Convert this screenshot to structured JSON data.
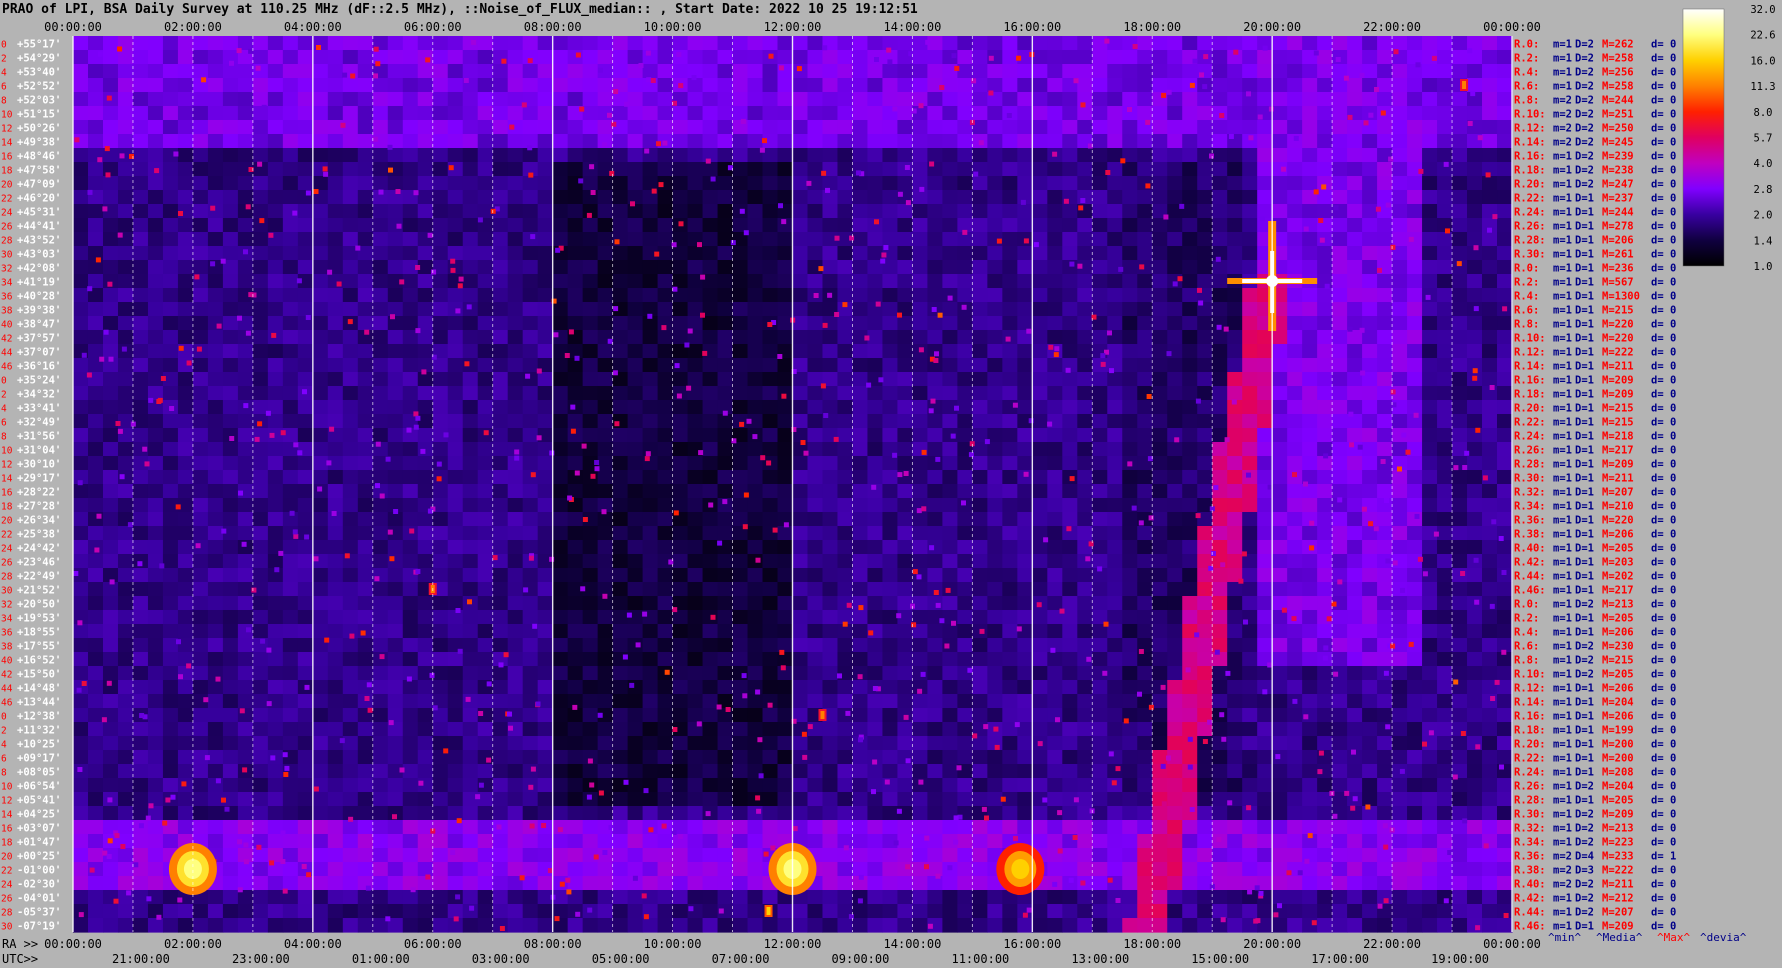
{
  "chart_data": {
    "type": "heatmap",
    "title": "PRAO of LPI, BSA Daily Survey at 110.25 MHz (dF::2.5 MHz), ::Noise_of_FLUX_median:: , Start Date: 2022 10 25 19:12:51",
    "xlabel_ra": "RA >>",
    "xlabel_utc": "UTC>>",
    "ra_ticks": [
      "00:00:00",
      "02:00:00",
      "04:00:00",
      "06:00:00",
      "08:00:00",
      "10:00:00",
      "12:00:00",
      "14:00:00",
      "16:00:00",
      "18:00:00",
      "20:00:00",
      "22:00:00",
      "00:00:00"
    ],
    "utc_ticks": [
      "21:00:00",
      "23:00:00",
      "01:00:00",
      "03:00:00",
      "05:00:00",
      "07:00:00",
      "09:00:00",
      "11:00:00",
      "13:00:00",
      "15:00:00",
      "17:00:00",
      "19:00:00"
    ],
    "dec_labels": [
      "+55°17'",
      "+54°29'",
      "+53°40'",
      "+52°52'",
      "+52°03'",
      "+51°15'",
      "+50°26'",
      "+49°38'",
      "+48°46'",
      "+47°58'",
      "+47°09'",
      "+46°20'",
      "+45°31'",
      "+44°41'",
      "+43°52'",
      "+43°03'",
      "+42°08'",
      "+41°19'",
      "+40°28'",
      "+39°38'",
      "+38°47'",
      "+37°57'",
      "+37°07'",
      "+36°16'",
      "+35°24'",
      "+34°32'",
      "+33°41'",
      "+32°49'",
      "+31°56'",
      "+31°04'",
      "+30°10'",
      "+29°17'",
      "+28°22'",
      "+27°28'",
      "+26°34'",
      "+25°38'",
      "+24°42'",
      "+23°46'",
      "+22°49'",
      "+21°52'",
      "+20°50'",
      "+19°53'",
      "+18°55'",
      "+17°55'",
      "+16°52'",
      "+15°50'",
      "+14°48'",
      "+13°44'",
      "+12°38'",
      "+11°32'",
      "+10°25'",
      "+09°17'",
      "+08°05'",
      "+06°54'",
      "+05°41'",
      "+04°25'",
      "+03°07'",
      "+01°47'",
      "+00°25'",
      "-01°00'",
      "-02°30'",
      "-04°01'",
      "-05°37'",
      "-07°19'"
    ],
    "row_index": [
      "0",
      "2",
      "4",
      "6",
      "8",
      "10",
      "12",
      "14",
      "16",
      "18",
      "20",
      "22",
      "24",
      "26",
      "28",
      "30",
      "32",
      "34",
      "36",
      "38",
      "40",
      "42",
      "44",
      "46",
      "0",
      "2",
      "4",
      "6",
      "8",
      "10",
      "12",
      "14",
      "16",
      "18",
      "20",
      "22",
      "24",
      "26",
      "28",
      "30",
      "32",
      "34",
      "36",
      "38",
      "40",
      "42",
      "44",
      "46",
      "0",
      "2",
      "4",
      "6",
      "8",
      "10",
      "12",
      "14",
      "16",
      "18",
      "20",
      "22",
      "24",
      "26",
      "28",
      "30"
    ],
    "row_stats": [
      {
        "r": "R.0:",
        "m": "m=1",
        "D": "D=2",
        "M": "M=262",
        "d": "d= 0"
      },
      {
        "r": "R.2:",
        "m": "m=1",
        "D": "D=2",
        "M": "M=258",
        "d": "d= 0"
      },
      {
        "r": "R.4:",
        "m": "m=1",
        "D": "D=2",
        "M": "M=256",
        "d": "d= 0"
      },
      {
        "r": "R.6:",
        "m": "m=1",
        "D": "D=2",
        "M": "M=258",
        "d": "d= 0"
      },
      {
        "r": "R.8:",
        "m": "m=2",
        "D": "D=2",
        "M": "M=244",
        "d": "d= 0"
      },
      {
        "r": "R.10:",
        "m": "m=2",
        "D": "D=2",
        "M": "M=251",
        "d": "d= 0"
      },
      {
        "r": "R.12:",
        "m": "m=2",
        "D": "D=2",
        "M": "M=250",
        "d": "d= 0"
      },
      {
        "r": "R.14:",
        "m": "m=2",
        "D": "D=2",
        "M": "M=245",
        "d": "d= 0"
      },
      {
        "r": "R.16:",
        "m": "m=1",
        "D": "D=2",
        "M": "M=239",
        "d": "d= 0"
      },
      {
        "r": "R.18:",
        "m": "m=1",
        "D": "D=2",
        "M": "M=238",
        "d": "d= 0"
      },
      {
        "r": "R.20:",
        "m": "m=1",
        "D": "D=2",
        "M": "M=247",
        "d": "d= 0"
      },
      {
        "r": "R.22:",
        "m": "m=1",
        "D": "D=1",
        "M": "M=237",
        "d": "d= 0"
      },
      {
        "r": "R.24:",
        "m": "m=1",
        "D": "D=1",
        "M": "M=244",
        "d": "d= 0"
      },
      {
        "r": "R.26:",
        "m": "m=1",
        "D": "D=1",
        "M": "M=278",
        "d": "d= 0"
      },
      {
        "r": "R.28:",
        "m": "m=1",
        "D": "D=1",
        "M": "M=206",
        "d": "d= 0"
      },
      {
        "r": "R.30:",
        "m": "m=1",
        "D": "D=1",
        "M": "M=261",
        "d": "d= 0"
      },
      {
        "r": "R.0:",
        "m": "m=1",
        "D": "D=1",
        "M": "M=236",
        "d": "d= 0"
      },
      {
        "r": "R.2:",
        "m": "m=1",
        "D": "D=1",
        "M": "M=567",
        "d": "d= 0"
      },
      {
        "r": "R.4:",
        "m": "m=1",
        "D": "D=1",
        "M": "M=1300",
        "d": "d= 0"
      },
      {
        "r": "R.6:",
        "m": "m=1",
        "D": "D=1",
        "M": "M=215",
        "d": "d= 0"
      },
      {
        "r": "R.8:",
        "m": "m=1",
        "D": "D=1",
        "M": "M=220",
        "d": "d= 0"
      },
      {
        "r": "R.10:",
        "m": "m=1",
        "D": "D=1",
        "M": "M=220",
        "d": "d= 0"
      },
      {
        "r": "R.12:",
        "m": "m=1",
        "D": "D=1",
        "M": "M=222",
        "d": "d= 0"
      },
      {
        "r": "R.14:",
        "m": "m=1",
        "D": "D=1",
        "M": "M=211",
        "d": "d= 0"
      },
      {
        "r": "R.16:",
        "m": "m=1",
        "D": "D=1",
        "M": "M=209",
        "d": "d= 0"
      },
      {
        "r": "R.18:",
        "m": "m=1",
        "D": "D=1",
        "M": "M=209",
        "d": "d= 0"
      },
      {
        "r": "R.20:",
        "m": "m=1",
        "D": "D=1",
        "M": "M=215",
        "d": "d= 0"
      },
      {
        "r": "R.22:",
        "m": "m=1",
        "D": "D=1",
        "M": "M=215",
        "d": "d= 0"
      },
      {
        "r": "R.24:",
        "m": "m=1",
        "D": "D=1",
        "M": "M=218",
        "d": "d= 0"
      },
      {
        "r": "R.26:",
        "m": "m=1",
        "D": "D=1",
        "M": "M=217",
        "d": "d= 0"
      },
      {
        "r": "R.28:",
        "m": "m=1",
        "D": "D=1",
        "M": "M=209",
        "d": "d= 0"
      },
      {
        "r": "R.30:",
        "m": "m=1",
        "D": "D=1",
        "M": "M=211",
        "d": "d= 0"
      },
      {
        "r": "R.32:",
        "m": "m=1",
        "D": "D=1",
        "M": "M=207",
        "d": "d= 0"
      },
      {
        "r": "R.34:",
        "m": "m=1",
        "D": "D=1",
        "M": "M=210",
        "d": "d= 0"
      },
      {
        "r": "R.36:",
        "m": "m=1",
        "D": "D=1",
        "M": "M=220",
        "d": "d= 0"
      },
      {
        "r": "R.38:",
        "m": "m=1",
        "D": "D=1",
        "M": "M=206",
        "d": "d= 0"
      },
      {
        "r": "R.40:",
        "m": "m=1",
        "D": "D=1",
        "M": "M=205",
        "d": "d= 0"
      },
      {
        "r": "R.42:",
        "m": "m=1",
        "D": "D=1",
        "M": "M=203",
        "d": "d= 0"
      },
      {
        "r": "R.44:",
        "m": "m=1",
        "D": "D=1",
        "M": "M=202",
        "d": "d= 0"
      },
      {
        "r": "R.46:",
        "m": "m=1",
        "D": "D=1",
        "M": "M=217",
        "d": "d= 0"
      },
      {
        "r": "R.0:",
        "m": "m=1",
        "D": "D=2",
        "M": "M=213",
        "d": "d= 0"
      },
      {
        "r": "R.2:",
        "m": "m=1",
        "D": "D=1",
        "M": "M=205",
        "d": "d= 0"
      },
      {
        "r": "R.4:",
        "m": "m=1",
        "D": "D=1",
        "M": "M=206",
        "d": "d= 0"
      },
      {
        "r": "R.6:",
        "m": "m=1",
        "D": "D=2",
        "M": "M=230",
        "d": "d= 0"
      },
      {
        "r": "R.8:",
        "m": "m=1",
        "D": "D=2",
        "M": "M=215",
        "d": "d= 0"
      },
      {
        "r": "R.10:",
        "m": "m=1",
        "D": "D=2",
        "M": "M=205",
        "d": "d= 0"
      },
      {
        "r": "R.12:",
        "m": "m=1",
        "D": "D=1",
        "M": "M=206",
        "d": "d= 0"
      },
      {
        "r": "R.14:",
        "m": "m=1",
        "D": "D=1",
        "M": "M=204",
        "d": "d= 0"
      },
      {
        "r": "R.16:",
        "m": "m=1",
        "D": "D=1",
        "M": "M=206",
        "d": "d= 0"
      },
      {
        "r": "R.18:",
        "m": "m=1",
        "D": "D=1",
        "M": "M=199",
        "d": "d= 0"
      },
      {
        "r": "R.20:",
        "m": "m=1",
        "D": "D=1",
        "M": "M=200",
        "d": "d= 0"
      },
      {
        "r": "R.22:",
        "m": "m=1",
        "D": "D=1",
        "M": "M=200",
        "d": "d= 0"
      },
      {
        "r": "R.24:",
        "m": "m=1",
        "D": "D=1",
        "M": "M=208",
        "d": "d= 0"
      },
      {
        "r": "R.26:",
        "m": "m=1",
        "D": "D=2",
        "M": "M=204",
        "d": "d= 0"
      },
      {
        "r": "R.28:",
        "m": "m=1",
        "D": "D=1",
        "M": "M=205",
        "d": "d= 0"
      },
      {
        "r": "R.30:",
        "m": "m=1",
        "D": "D=2",
        "M": "M=209",
        "d": "d= 0"
      },
      {
        "r": "R.32:",
        "m": "m=1",
        "D": "D=2",
        "M": "M=213",
        "d": "d= 0"
      },
      {
        "r": "R.34:",
        "m": "m=1",
        "D": "D=2",
        "M": "M=223",
        "d": "d= 0"
      },
      {
        "r": "R.36:",
        "m": "m=2",
        "D": "D=4",
        "M": "M=233",
        "d": "d= 1"
      },
      {
        "r": "R.38:",
        "m": "m=2",
        "D": "D=3",
        "M": "M=222",
        "d": "d= 0"
      },
      {
        "r": "R.40:",
        "m": "m=2",
        "D": "D=2",
        "M": "M=211",
        "d": "d= 0"
      },
      {
        "r": "R.42:",
        "m": "m=1",
        "D": "D=2",
        "M": "M=212",
        "d": "d= 0"
      },
      {
        "r": "R.44:",
        "m": "m=1",
        "D": "D=2",
        "M": "M=207",
        "d": "d= 0"
      },
      {
        "r": "R.46:",
        "m": "m=1",
        "D": "D=1",
        "M": "M=209",
        "d": "d= 0"
      }
    ],
    "stats_legend": [
      {
        "text": "^min^",
        "color": "#000088"
      },
      {
        "text": "^Media^",
        "color": "#000088"
      },
      {
        "text": "^Max^",
        "color": "#ff0000"
      },
      {
        "text": "^devia^",
        "color": "#000088"
      }
    ],
    "colorbar": {
      "ticks": [
        "32.0",
        "22.6",
        "16.0",
        "11.3",
        "8.0",
        "5.7",
        "4.0",
        "2.8",
        "2.0",
        "1.4",
        "1.0"
      ],
      "colors": [
        "#ffffff",
        "#ffff80",
        "#ffd000",
        "#ff8000",
        "#ff2000",
        "#e00060",
        "#c000c0",
        "#8000ff",
        "#3800a0",
        "#100040",
        "#000000"
      ]
    },
    "bright_sources": [
      {
        "ra_h": 20.0,
        "dec_row": 17,
        "level": 32.0,
        "shape": "cross"
      },
      {
        "ra_h": 2.0,
        "dec_row": 59,
        "level": 22.6,
        "shape": "blob"
      },
      {
        "ra_h": 12.0,
        "dec_row": 59,
        "level": 22.6,
        "shape": "blob"
      },
      {
        "ra_h": 15.8,
        "dec_row": 59,
        "level": 16.0,
        "shape": "blob"
      },
      {
        "ra_h": 11.6,
        "dec_row": 62,
        "level": 16.0,
        "shape": "dot"
      },
      {
        "ra_h": 6.0,
        "dec_row": 39,
        "level": 11.3,
        "shape": "dot"
      },
      {
        "ra_h": 23.2,
        "dec_row": 3,
        "level": 11.3,
        "shape": "dot"
      },
      {
        "ra_h": 12.5,
        "dec_row": 48,
        "level": 11.3,
        "shape": "dot"
      }
    ],
    "colors": {
      "background": "#b4b4b4",
      "title_text": "#000000",
      "dec_label_text": "#ffffff",
      "stat_label": "#ff0000",
      "stat_value": "#000088",
      "stat_value_white": "#ffffff"
    }
  }
}
